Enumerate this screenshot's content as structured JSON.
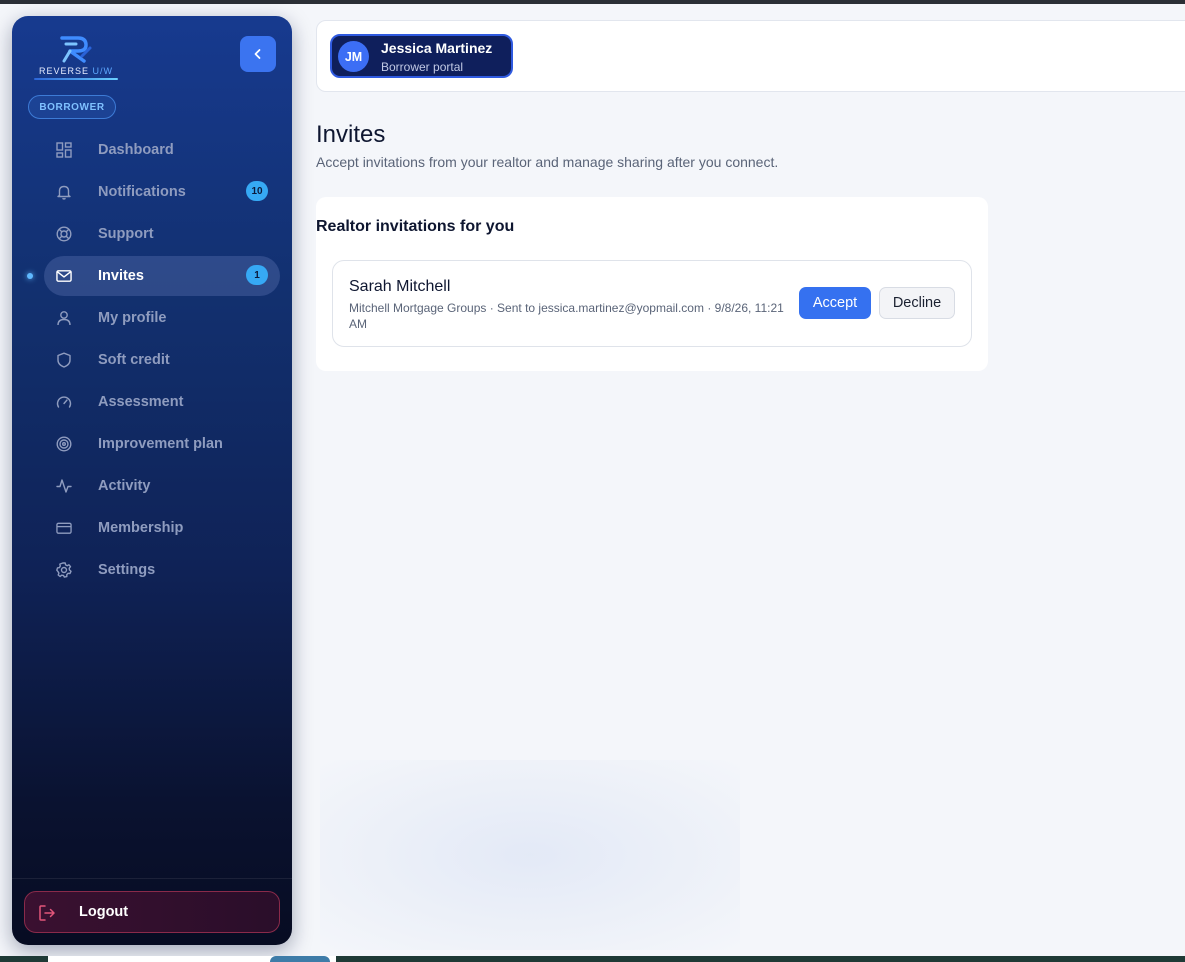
{
  "brand": {
    "logo_text": "REVERSE",
    "logo_text_accent": "U/W"
  },
  "sidebar": {
    "role_label": "BORROWER",
    "items": [
      {
        "label": "Dashboard",
        "icon": "dashboard-icon"
      },
      {
        "label": "Notifications",
        "icon": "bell-icon",
        "badge": "10"
      },
      {
        "label": "Support",
        "icon": "lifebuoy-icon"
      },
      {
        "label": "Invites",
        "icon": "mail-icon",
        "badge": "1",
        "active": true
      },
      {
        "label": "My profile",
        "icon": "user-icon"
      },
      {
        "label": "Soft credit",
        "icon": "shield-icon"
      },
      {
        "label": "Assessment",
        "icon": "gauge-icon"
      },
      {
        "label": "Improvement plan",
        "icon": "target-icon"
      },
      {
        "label": "Activity",
        "icon": "activity-icon"
      },
      {
        "label": "Membership",
        "icon": "credit-card-icon"
      },
      {
        "label": "Settings",
        "icon": "gear-icon"
      }
    ],
    "logout_label": "Logout"
  },
  "header": {
    "user_initials": "JM",
    "user_name": "Jessica Martinez",
    "user_role": "Borrower portal"
  },
  "main": {
    "title": "Invites",
    "subtitle": "Accept invitations from your realtor and manage sharing after you connect.",
    "section_title": "Realtor invitations for you",
    "invites": [
      {
        "name": "Sarah Mitchell",
        "meta": "Mitchell Mortgage Groups · Sent to jessica.martinez@yopmail.com · 9/8/26, 11:21 AM",
        "accept_label": "Accept",
        "decline_label": "Decline"
      }
    ]
  },
  "colors": {
    "accent": "#3571f0",
    "sidebar_top": "#173a8f",
    "sidebar_bottom": "#070c22",
    "badge": "#36a9f5"
  }
}
